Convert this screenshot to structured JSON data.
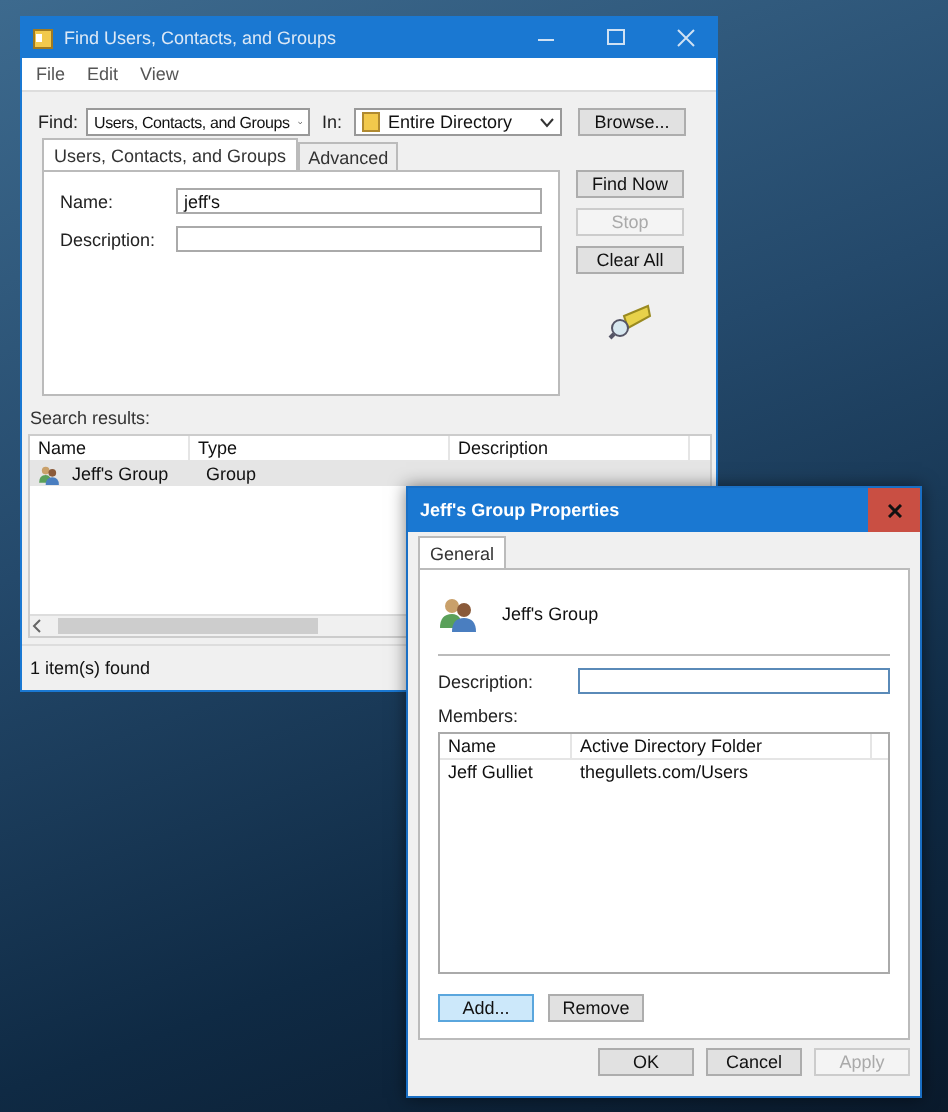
{
  "find_window": {
    "title": "Find Users, Contacts, and Groups",
    "menu": [
      "File",
      "Edit",
      "View"
    ],
    "find_label": "Find:",
    "find_value": "Users, Contacts, and Groups",
    "in_label": "In:",
    "in_value": "Entire Directory",
    "browse_button": "Browse...",
    "tabs": [
      {
        "label": "Users, Contacts, and Groups",
        "selected": true
      },
      {
        "label": "Advanced",
        "selected": false
      }
    ],
    "fields": [
      {
        "label": "Name:",
        "value": "jeff's"
      },
      {
        "label": "Description:"
      }
    ],
    "actions": [
      {
        "label": "Find Now",
        "disabled": false
      },
      {
        "label": "Stop",
        "disabled": true
      },
      {
        "label": "Clear All",
        "disabled": false
      }
    ],
    "results_label": "Search results:",
    "results": {
      "columns": [
        "Name",
        "Type",
        "Description"
      ],
      "rows": [
        {
          "name": "Jeff's Group",
          "type": "Group",
          "selected": true
        }
      ]
    },
    "status_bar": "1 item(s) found"
  },
  "properties_window": {
    "title": "Jeff's Group Properties",
    "tabs": [
      {
        "label": "General",
        "selected": true
      }
    ],
    "group_name": "Jeff's Group",
    "description_label": "Description:",
    "members_label": "Members:",
    "members": {
      "columns": [
        "Name",
        "Active Directory Folder"
      ],
      "rows": [
        {
          "name": "Jeff Gulliet",
          "folder": "thegullets.com/Users"
        }
      ]
    },
    "member_buttons": [
      {
        "label": "Add...",
        "focused": true
      },
      {
        "label": "Remove",
        "focused": false
      }
    ],
    "dialog_buttons": [
      {
        "label": "OK",
        "disabled": false
      },
      {
        "label": "Cancel",
        "disabled": false
      },
      {
        "label": "Apply",
        "disabled": true
      }
    ]
  }
}
